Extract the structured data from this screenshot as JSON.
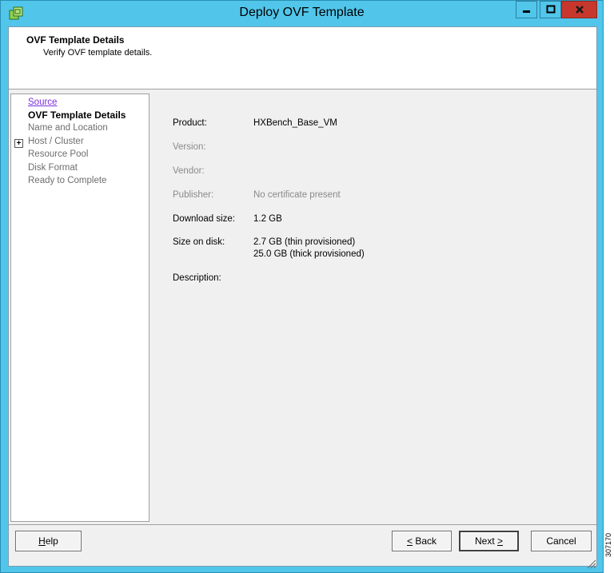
{
  "window": {
    "title": "Deploy OVF Template"
  },
  "header": {
    "title": "OVF Template Details",
    "subtitle": "Verify OVF template details."
  },
  "nav": {
    "items": [
      {
        "label": "Source",
        "state": "link"
      },
      {
        "label": "OVF Template Details",
        "state": "active"
      },
      {
        "label": "Name and Location",
        "state": "disabled"
      },
      {
        "label": "Host / Cluster",
        "state": "disabled",
        "expander": "+"
      },
      {
        "label": "Resource Pool",
        "state": "disabled"
      },
      {
        "label": "Disk Format",
        "state": "disabled"
      },
      {
        "label": "Ready to Complete",
        "state": "disabled"
      }
    ]
  },
  "details": {
    "product_label": "Product:",
    "product_value": "HXBench_Base_VM",
    "version_label": "Version:",
    "vendor_label": "Vendor:",
    "publisher_label": "Publisher:",
    "publisher_value": "No certificate present",
    "download_label": "Download size:",
    "download_value": "1.2 GB",
    "disk_label": "Size on disk:",
    "disk_value_thin": "2.7 GB (thin provisioned)",
    "disk_value_thick": "25.0 GB (thick provisioned)",
    "description_label": "Description:"
  },
  "buttons": {
    "help_accel": "H",
    "help_rest": "elp",
    "back_accel": "<",
    "back_rest": " Back",
    "next_prefix": "Next ",
    "next_accel": ">",
    "cancel": "Cancel"
  },
  "figure_number": "307170",
  "colors": {
    "titlebar": "#51c6ea",
    "close": "#c7372d",
    "link": "#7a2fe0"
  }
}
